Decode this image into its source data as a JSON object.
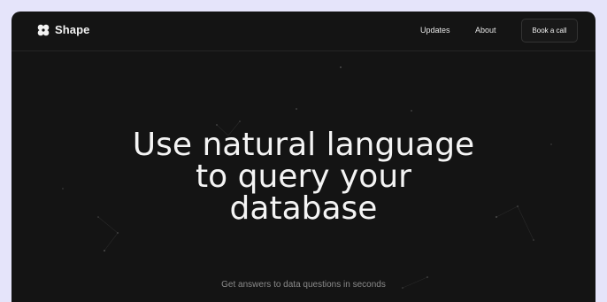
{
  "header": {
    "brand_name": "Shape",
    "brand_icon": "clover-logo-icon",
    "nav": [
      {
        "label": "Updates"
      },
      {
        "label": "About"
      }
    ],
    "cta_label": "Book a call"
  },
  "hero": {
    "title_lines": [
      "Use natural language",
      "to query your",
      "database"
    ],
    "subtitle": "Get answers to data questions in seconds"
  },
  "colors": {
    "page_background": "#e5e4fa",
    "frame_background": "#141414",
    "text_primary": "#f4f4f4",
    "text_muted": "#8a8a8a"
  }
}
